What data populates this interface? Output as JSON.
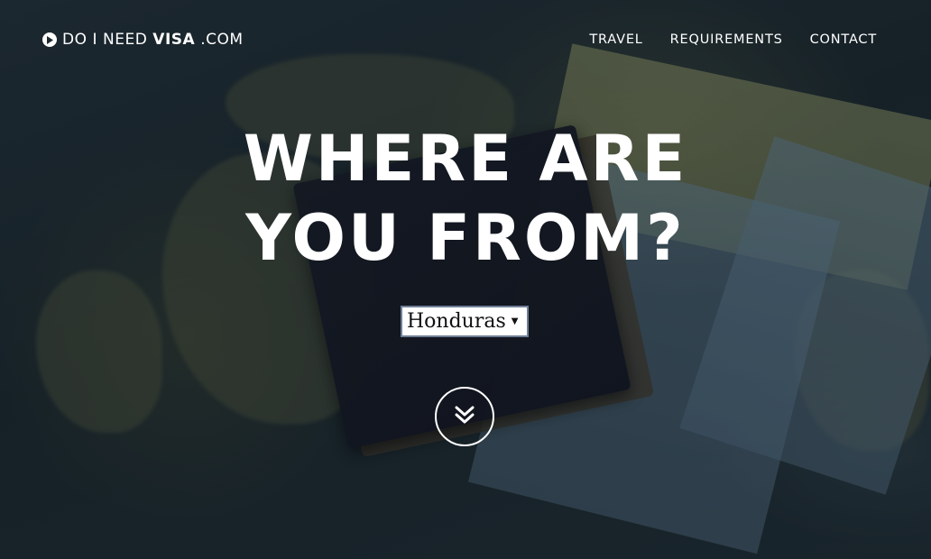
{
  "brand": {
    "part1": "DO",
    "part2": "I",
    "part3": "NEED",
    "bold": "VISA",
    "suffix": ".COM",
    "icon": "play-circle-icon"
  },
  "nav": {
    "items": [
      {
        "label": "TRAVEL"
      },
      {
        "label": "REQUIREMENTS"
      },
      {
        "label": "CONTACT"
      }
    ]
  },
  "hero": {
    "line1": "WHERE ARE",
    "line2": "YOU FROM?"
  },
  "country_select": {
    "value": "Honduras",
    "arrow_icon": "caret-down-icon"
  },
  "scroll_button": {
    "icon": "double-chevron-down-icon"
  },
  "colors": {
    "text": "#ffffff",
    "select_border": "#6f7f96"
  }
}
